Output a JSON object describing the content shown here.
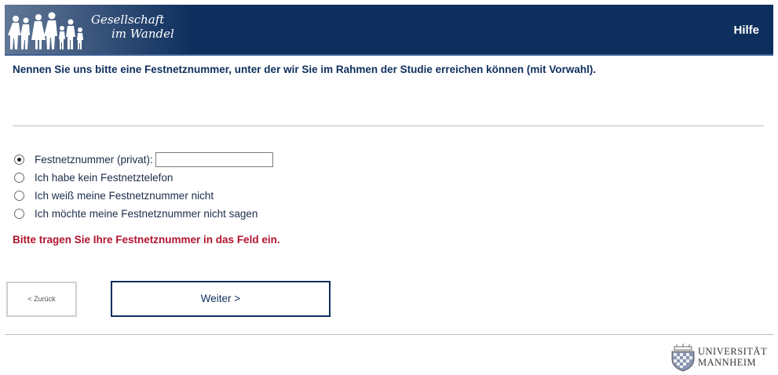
{
  "header": {
    "logo_line1": "Gesellschaft",
    "logo_line2": "im Wandel",
    "help_label": "Hilfe",
    "background_color": "#0e2f5e"
  },
  "question": {
    "text": "Nennen Sie uns bitte eine Festnetznummer, unter der wir Sie im Rahmen der Studie erreichen können (mit Vorwahl)."
  },
  "options": [
    {
      "label": "Festnetznummer (privat):",
      "selected": true,
      "has_input": true,
      "input_value": ""
    },
    {
      "label": "Ich habe kein Festnetztelefon",
      "selected": false
    },
    {
      "label": "Ich weiß meine Festnetznummer nicht",
      "selected": false
    },
    {
      "label": "Ich möchte meine Festnetznummer nicht sagen",
      "selected": false
    }
  ],
  "error": {
    "text": "Bitte tragen Sie Ihre Festnetznummer in das Feld ein.",
    "color": "#b0152d"
  },
  "navigation": {
    "back_label": "< Zurück",
    "next_label": "Weiter >"
  },
  "footer": {
    "university_line1": "UNIVERSITÄT",
    "university_line2": "MANNHEIM"
  }
}
